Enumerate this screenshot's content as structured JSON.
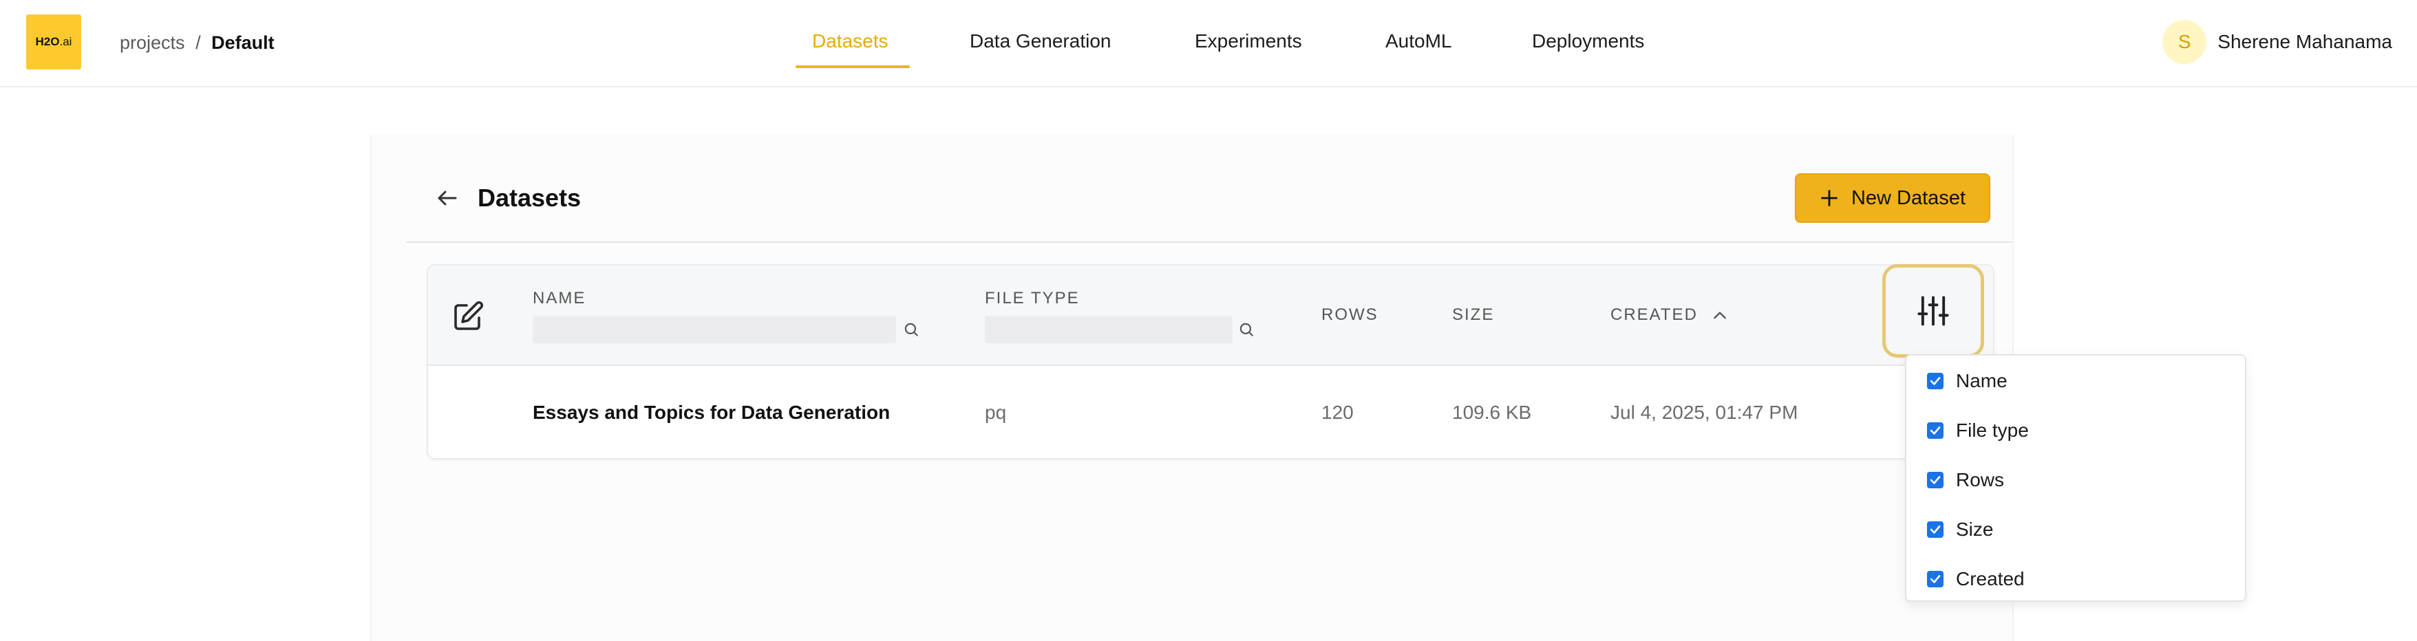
{
  "header": {
    "logo": {
      "brand": "H2O",
      "suffix": ".ai"
    },
    "breadcrumb": {
      "parent": "projects",
      "separator": "/",
      "current": "Default"
    },
    "nav": [
      {
        "label": "Datasets",
        "active": true
      },
      {
        "label": "Data Generation",
        "active": false
      },
      {
        "label": "Experiments",
        "active": false
      },
      {
        "label": "AutoML",
        "active": false
      },
      {
        "label": "Deployments",
        "active": false
      }
    ],
    "user": {
      "initial": "S",
      "name": "Sherene Mahanama"
    }
  },
  "page": {
    "title": "Datasets",
    "new_button_label": "New Dataset"
  },
  "table": {
    "columns": {
      "name": "NAME",
      "file_type": "FILE TYPE",
      "rows": "ROWS",
      "size": "SIZE",
      "created": "CREATED"
    },
    "sort": {
      "column": "created",
      "direction": "asc"
    },
    "filters": {
      "name": "",
      "file_type": ""
    },
    "rows": [
      {
        "name": "Essays and Topics for Data Generation",
        "file_type": "pq",
        "rows": "120",
        "size": "109.6 KB",
        "created": "Jul 4, 2025, 01:47 PM"
      }
    ]
  },
  "column_menu": {
    "options": [
      {
        "label": "Name",
        "checked": true
      },
      {
        "label": "File type",
        "checked": true
      },
      {
        "label": "Rows",
        "checked": true
      },
      {
        "label": "Size",
        "checked": true
      },
      {
        "label": "Created",
        "checked": true
      }
    ]
  },
  "colors": {
    "accent": "#efb21a",
    "active_tab": "#e8aa0c",
    "checkbox": "#1a73e8"
  },
  "icons": {
    "back": "arrow-left-icon",
    "add": "plus-icon",
    "edit": "edit-icon",
    "search": "search-icon",
    "sort": "chevron-up-icon",
    "columns": "sliders-icon",
    "check": "check-icon"
  }
}
